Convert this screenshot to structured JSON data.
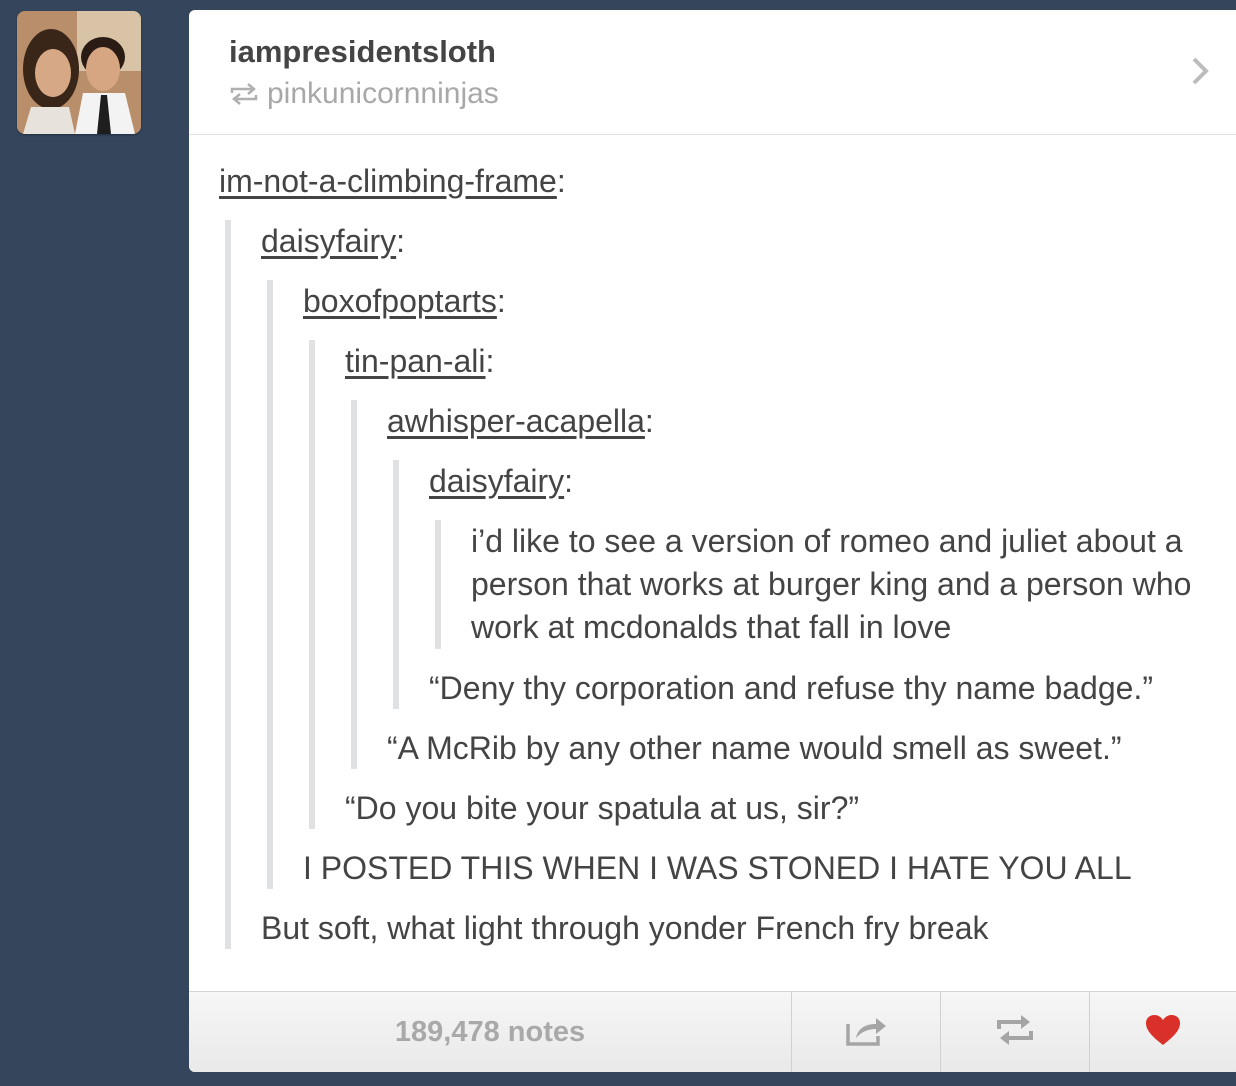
{
  "header": {
    "author": "iampresidentsloth",
    "reblogged_from": "pinkunicornninjas"
  },
  "thread": {
    "level1": {
      "user": "im-not-a-climbing-frame",
      "colon": ":"
    },
    "level2": {
      "user": "daisyfairy",
      "colon": ":"
    },
    "level3": {
      "user": "boxofpoptarts",
      "colon": ":"
    },
    "level4": {
      "user": "tin-pan-ali",
      "colon": ":"
    },
    "level5": {
      "user": "awhisper-acapella",
      "colon": ":"
    },
    "level6": {
      "user": "daisyfairy",
      "colon": ":"
    },
    "original_post": "i’d like to see a version of romeo and juliet about a person that works at burger king and a person who work at mcdonalds that fall in love",
    "reply_level6": "“Deny thy corporation and refuse thy name badge.”",
    "reply_level5": "“A McRib by any other name would smell as sweet.”",
    "reply_level4": "“Do you bite your spatula at us, sir?”",
    "reply_level3": "I POSTED THIS WHEN I WAS STONED I HATE YOU ALL",
    "reply_level2": "But soft, what light through yonder French fry break"
  },
  "footer": {
    "notes": "189,478 notes",
    "share_icon": "share-icon",
    "reblog_icon": "reblog-icon",
    "like_icon": "heart-icon",
    "like_color": "#d9302a"
  },
  "colors": {
    "background": "#35465c",
    "text": "#444444",
    "muted": "#a8a8a8",
    "quote_border": "#e0e1e3"
  }
}
